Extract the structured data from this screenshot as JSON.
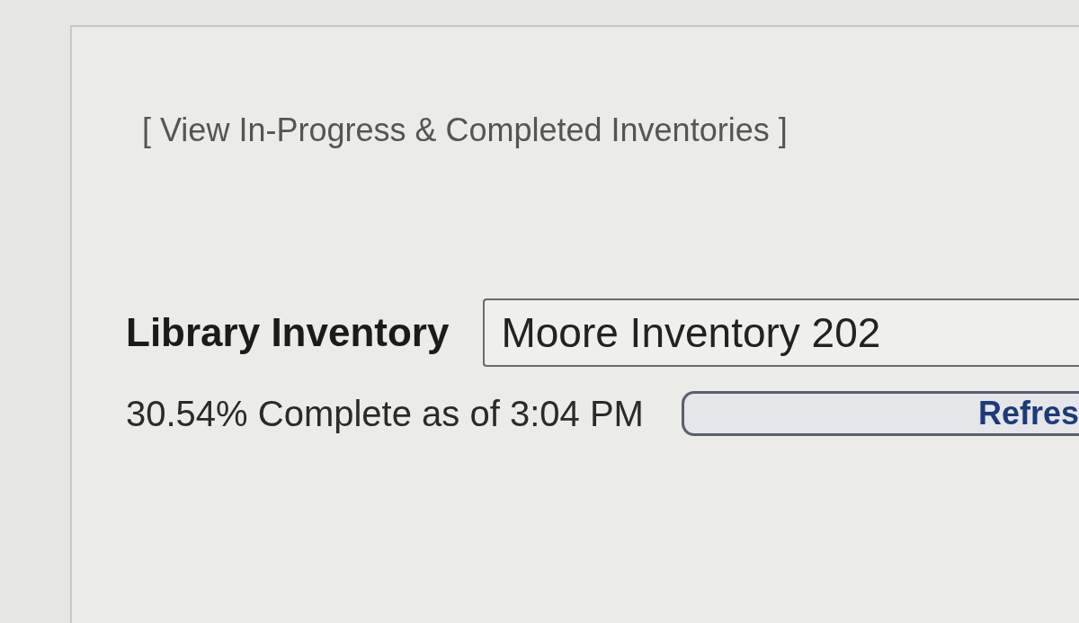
{
  "link": {
    "text": "[ View In-Progress & Completed Inventories ]"
  },
  "inventory": {
    "label": "Library Inventory",
    "value": "Moore Inventory 202"
  },
  "status": {
    "text": "30.54% Complete as of 3:04 PM"
  },
  "buttons": [
    {
      "label": "Refres"
    }
  ]
}
